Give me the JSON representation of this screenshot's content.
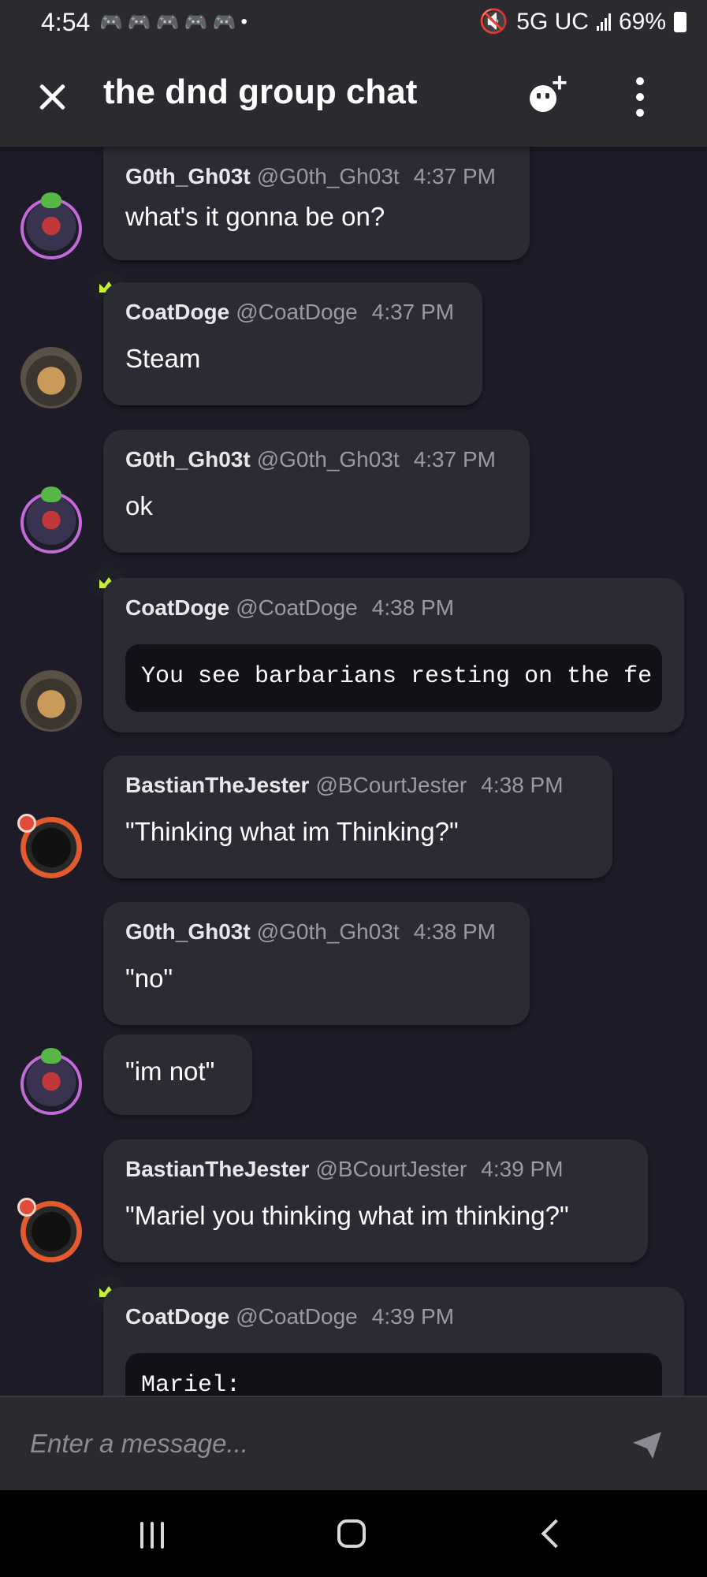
{
  "status_bar": {
    "time": "4:54",
    "notification_icons": [
      "discord-icon",
      "discord-icon",
      "discord-icon",
      "discord-icon",
      "discord-icon"
    ],
    "dot": "•",
    "network": "5G UC",
    "battery": "69%"
  },
  "header": {
    "title": "the dnd group chat"
  },
  "messages": [
    {
      "author": "G0th_Gh03t",
      "handle": "@G0th_Gh03t",
      "time": "4:37 PM",
      "text": "what's it gonna be on?",
      "avatar": "goth"
    },
    {
      "author": "CoatDoge",
      "handle": "@CoatDoge",
      "time": "4:37 PM",
      "text": "Steam",
      "avatar": "doge",
      "crown": true
    },
    {
      "author": "G0th_Gh03t",
      "handle": "@G0th_Gh03t",
      "time": "4:37 PM",
      "text": "ok",
      "avatar": "goth"
    },
    {
      "author": "CoatDoge",
      "handle": "@CoatDoge",
      "time": "4:38 PM",
      "code": "You see barbarians resting on the fe",
      "avatar": "doge",
      "crown": true
    },
    {
      "author": "BastianTheJester",
      "handle": "@BCourtJester",
      "time": "4:38 PM",
      "text": "\"Thinking what im Thinking?\"",
      "avatar": "bastian"
    },
    {
      "author": "G0th_Gh03t",
      "handle": "@G0th_Gh03t",
      "time": "4:38 PM",
      "text": "\"no\"",
      "avatar": "goth"
    },
    {
      "text": "\"im not\"",
      "continuation": true
    },
    {
      "author": "BastianTheJester",
      "handle": "@BCourtJester",
      "time": "4:39 PM",
      "text": "\"Mariel you thinking what im thinking?\"",
      "avatar": "bastian"
    },
    {
      "author": "CoatDoge",
      "handle": "@CoatDoge",
      "time": "4:39 PM",
      "code": "Mariel:",
      "avatar": "doge",
      "crown": true
    }
  ],
  "input": {
    "placeholder": "Enter a message..."
  },
  "colors": {
    "background": "#1c1b27",
    "bubble": "#2b2b33",
    "header": "#2a2a2f",
    "crown": "#c6f13a",
    "muted_text": "#9a9aa4"
  }
}
